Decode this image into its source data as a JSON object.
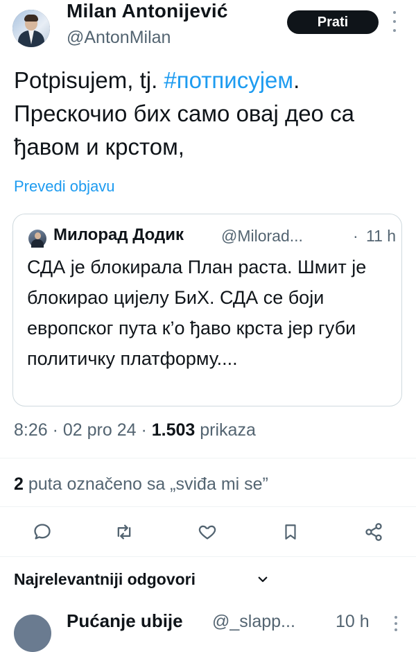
{
  "author": {
    "name": "Milan Antonijević",
    "handle": "@AntonMilan",
    "follow_label": "Prati"
  },
  "tweet": {
    "text_before_tag": "Potpisujem, tj. ",
    "hashtag": "#потписујем",
    "text_after_tag": ". Прескочио бих само овај део са ђавом и крстом,",
    "translate_label": "Prevedi objavu"
  },
  "quoted": {
    "name": "Милорад Додик",
    "handle": "@Milorad...",
    "separator": "·",
    "time": "11 h",
    "text": "СДА је блокирала План раста. Шмит је блокирао цијелу БиХ. СДА се боји европског пута к’о ђаво крста јер губи политичку платформу...."
  },
  "meta": {
    "time": "8:26",
    "date": "02 pro 24",
    "views_count": "1.503",
    "views_label": "prikaza"
  },
  "likes": {
    "count": "2",
    "label": "puta označeno sa „sviđa mi se”"
  },
  "actions": [
    "reply-icon",
    "retweet-icon",
    "like-icon",
    "bookmark-icon",
    "share-icon"
  ],
  "replies": {
    "heading": "Najrelevantniji odgovori",
    "first_reply": {
      "name": "Pućanje ubije",
      "handle": "@_slapp...",
      "time": "10 h"
    }
  },
  "colors": {
    "accent": "#1d9bf0",
    "text": "#0f1419",
    "muted": "#536471",
    "border": "#cfd9de",
    "follow_bg": "#0f1419"
  }
}
